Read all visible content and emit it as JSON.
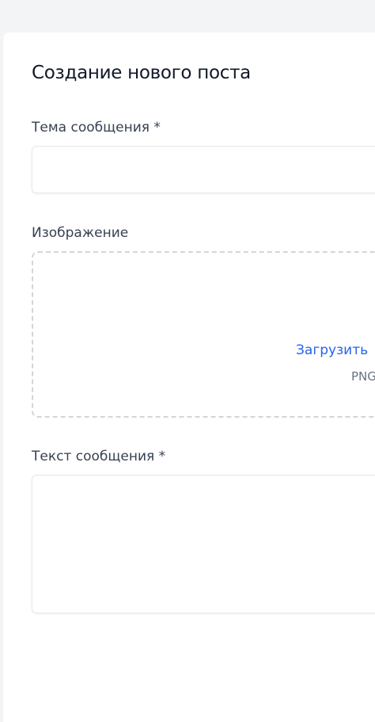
{
  "form": {
    "title": "Создание нового поста",
    "subject": {
      "label": "Тема сообщения *",
      "value": "",
      "placeholder": ""
    },
    "image": {
      "label": "Изображение",
      "upload_link": "Загрузить",
      "hint": "PNG"
    },
    "message": {
      "label": "Текст сообщения *",
      "value": "",
      "placeholder": ""
    }
  },
  "colors": {
    "background": "#f3f4f6",
    "card": "#ffffff",
    "link": "#2563eb",
    "border": "#e5e7eb",
    "dashed_border": "#d1d5db"
  }
}
